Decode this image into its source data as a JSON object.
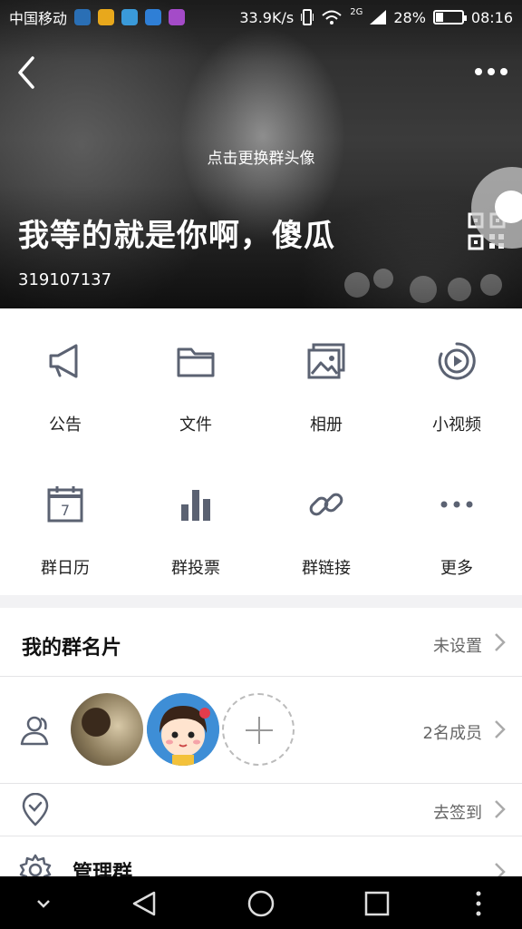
{
  "status_bar": {
    "carrier": "中国移动",
    "speed": "33.9K/s",
    "network": "2G",
    "battery": "28%",
    "battery_level": 0.28,
    "time": "08:16",
    "app_icon_colors": [
      "#2a6fb5",
      "#e8a81c",
      "#3a9ad9",
      "#2f7fd6",
      "#a44bc8"
    ]
  },
  "header": {
    "change_avatar_hint": "点击更换群头像",
    "group_name": "我等的就是你啊，傻瓜",
    "group_id": "319107137"
  },
  "features": [
    {
      "label": "公告",
      "icon": "megaphone-icon"
    },
    {
      "label": "文件",
      "icon": "folder-icon"
    },
    {
      "label": "相册",
      "icon": "photo-album-icon"
    },
    {
      "label": "小视频",
      "icon": "video-play-icon"
    },
    {
      "label": "群日历",
      "icon": "calendar-icon",
      "calendar_day": "7"
    },
    {
      "label": "群投票",
      "icon": "bar-chart-icon"
    },
    {
      "label": "群链接",
      "icon": "link-icon"
    },
    {
      "label": "更多",
      "icon": "more-dots-icon"
    }
  ],
  "rows": {
    "card": {
      "title": "我的群名片",
      "value": "未设置"
    },
    "members": {
      "value": "2名成员"
    },
    "checkin": {
      "value": "去签到"
    },
    "manage": {
      "title": "管理群"
    }
  },
  "colors": {
    "icon_gray": "#5b6272",
    "icon_accent": "#3a8ee6",
    "divider": "#e4e4e6"
  }
}
